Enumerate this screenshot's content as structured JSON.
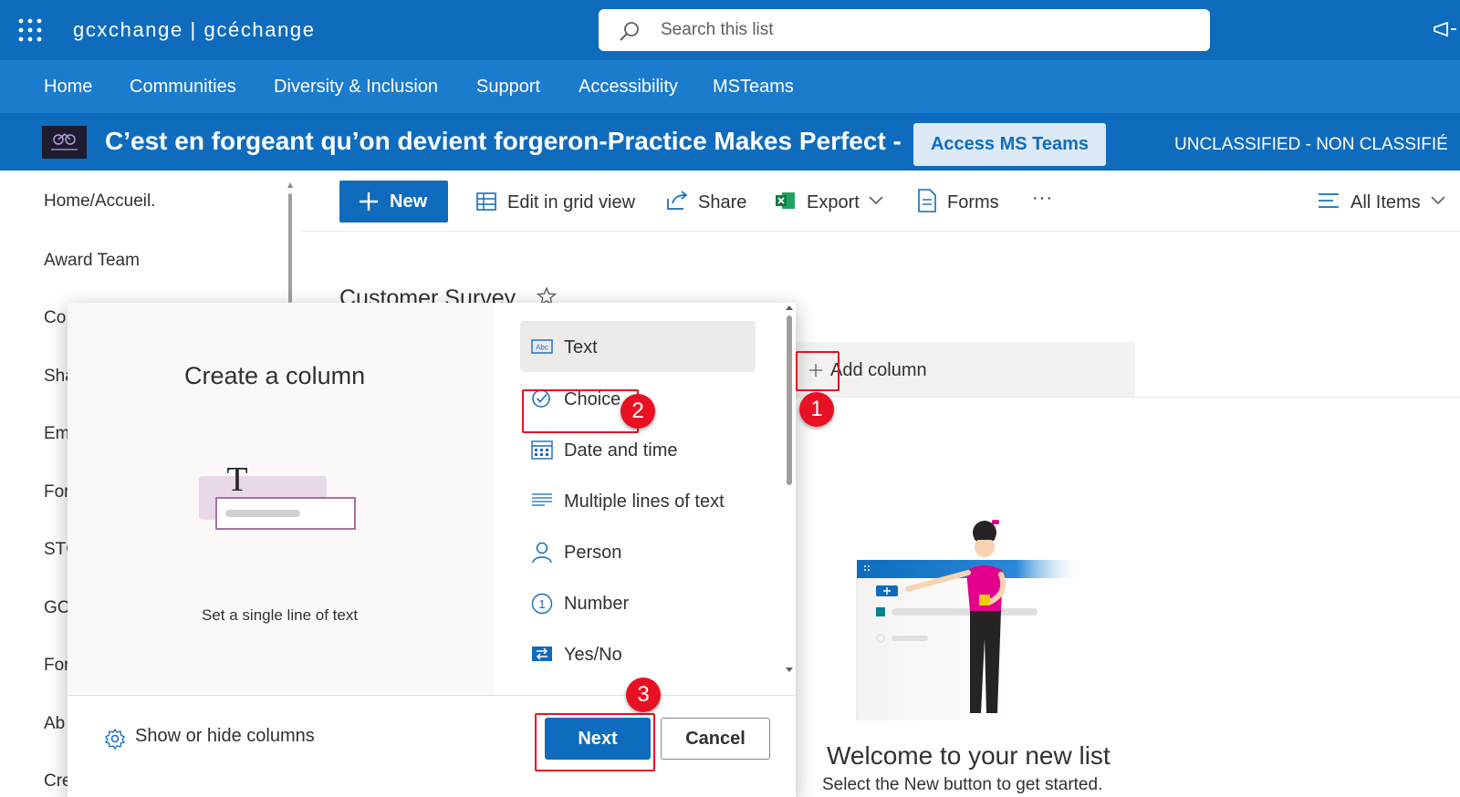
{
  "suite_bar": {
    "brand": "gcxchange | gcéchange",
    "search_placeholder": "Search this list"
  },
  "hub_nav": [
    "Home",
    "Communities",
    "Diversity & Inclusion",
    "Support",
    "Accessibility",
    "MSTeams"
  ],
  "site_header": {
    "title": "C’est en forgeant qu’on devient forgeron-Practice Makes Perfect -",
    "teams_button": "Access MS Teams",
    "classification": "UNCLASSIFIED - NON CLASSIFIÉ"
  },
  "left_nav": [
    "Home/Accueil.",
    "Award Team",
    "Co",
    "Sha",
    "Em",
    "For",
    "STC",
    "GC",
    "For",
    "Ab",
    "Cre"
  ],
  "command_bar": {
    "new": "New",
    "edit_grid": "Edit in grid view",
    "share": "Share",
    "export": "Export",
    "forms": "Forms",
    "more": "···",
    "view": "All Items"
  },
  "list": {
    "title": "Customer Survey",
    "add_column": "Add column"
  },
  "empty_state": {
    "title": "Welcome to your new list",
    "subtitle": "Select the New button to get started."
  },
  "dialog": {
    "title": "Create a column",
    "description": "Set a single line of text",
    "types": [
      {
        "label": "Text",
        "icon": "text-abc-icon",
        "selected": true
      },
      {
        "label": "Choice",
        "icon": "choice-check-icon",
        "selected": false
      },
      {
        "label": "Date and time",
        "icon": "calendar-icon",
        "selected": false
      },
      {
        "label": "Multiple lines of text",
        "icon": "multiline-text-icon",
        "selected": false
      },
      {
        "label": "Person",
        "icon": "person-icon",
        "selected": false
      },
      {
        "label": "Number",
        "icon": "number-icon",
        "selected": false
      },
      {
        "label": "Yes/No",
        "icon": "yes-no-icon",
        "selected": false
      }
    ],
    "show_hide": "Show or hide columns",
    "next": "Next",
    "cancel": "Cancel"
  },
  "annotations": [
    "1",
    "2",
    "3"
  ],
  "colors": {
    "suite_blue": "#0f6cbd",
    "hub_blue": "#1b7bcc",
    "callout_red": "#e81123"
  }
}
